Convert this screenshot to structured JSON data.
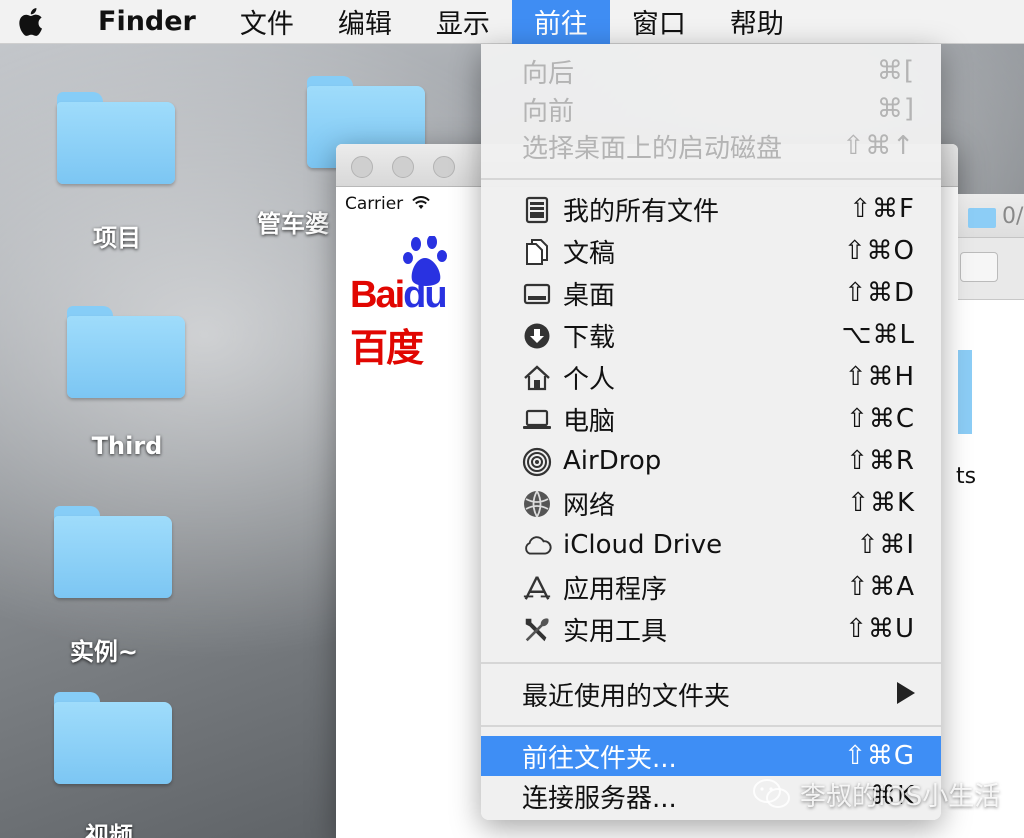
{
  "menubar": {
    "app": "Finder",
    "items": [
      "文件",
      "编辑",
      "显示",
      "前往",
      "窗口",
      "帮助"
    ],
    "active_index": 3
  },
  "desktop": {
    "folders": [
      "项目",
      "管车婆",
      "Third",
      "实例~",
      "视频"
    ]
  },
  "simulator": {
    "carrier": "Carrier",
    "logo_left": "Bai",
    "logo_du": "du",
    "logo_right": "百度"
  },
  "finder_peek": {
    "label_top": "0/",
    "label_side": "ts"
  },
  "go_menu": {
    "disabled": [
      {
        "label": "向后",
        "shortcut": "⌘["
      },
      {
        "label": "向前",
        "shortcut": "⌘]"
      },
      {
        "label": "选择桌面上的启动磁盘",
        "shortcut": "⇧⌘↑"
      }
    ],
    "places": [
      {
        "label": "我的所有文件",
        "shortcut": "⇧⌘F",
        "icon": "all-files-icon"
      },
      {
        "label": "文稿",
        "shortcut": "⇧⌘O",
        "icon": "documents-icon"
      },
      {
        "label": "桌面",
        "shortcut": "⇧⌘D",
        "icon": "desktop-icon"
      },
      {
        "label": "下载",
        "shortcut": "⌥⌘L",
        "icon": "downloads-icon"
      },
      {
        "label": "个人",
        "shortcut": "⇧⌘H",
        "icon": "home-icon"
      },
      {
        "label": "电脑",
        "shortcut": "⇧⌘C",
        "icon": "computer-icon"
      },
      {
        "label": "AirDrop",
        "shortcut": "⇧⌘R",
        "icon": "airdrop-icon"
      },
      {
        "label": "网络",
        "shortcut": "⇧⌘K",
        "icon": "network-icon"
      },
      {
        "label": "iCloud Drive",
        "shortcut": "⇧⌘I",
        "icon": "icloud-icon"
      },
      {
        "label": "应用程序",
        "shortcut": "⇧⌘A",
        "icon": "applications-icon"
      },
      {
        "label": "实用工具",
        "shortcut": "⇧⌘U",
        "icon": "utilities-icon"
      }
    ],
    "recent": {
      "label": "最近使用的文件夹"
    },
    "goto_folder": {
      "label": "前往文件夹...",
      "shortcut": "⇧⌘G"
    },
    "connect_server": {
      "label": "连接服务器...",
      "shortcut": "⌘K"
    }
  },
  "watermark": {
    "text": "李叔的iOS小生活"
  },
  "colors": {
    "highlight": "#3e8ef5",
    "folder": "#7cc6f3",
    "baidu_red": "#e10601",
    "baidu_blue": "#2932e1"
  }
}
